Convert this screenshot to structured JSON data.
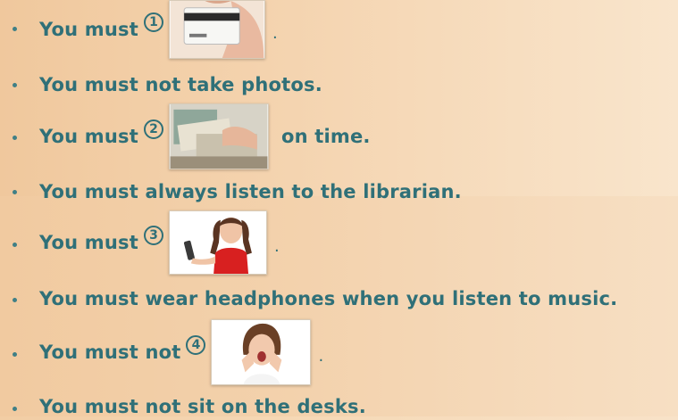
{
  "rules": [
    {
      "text_before": "You must",
      "number": "1",
      "photo": "card-photo",
      "text_after": "."
    },
    {
      "text": "You must not take photos."
    },
    {
      "text_before": "You must",
      "number": "2",
      "photo": "books-photo",
      "text_after": "on time."
    },
    {
      "text": "You must always listen to the librarian."
    },
    {
      "text_before": "You must",
      "number": "3",
      "photo": "phone-girl-photo",
      "text_after": "."
    },
    {
      "text": "You must wear headphones when you listen to music."
    },
    {
      "text_before": "You must not",
      "number": "4",
      "photo": "shouting-girl-photo",
      "text_after": "."
    },
    {
      "text": "You must not sit on the desks."
    }
  ],
  "colors": {
    "text": "#2f7078",
    "background": "#f5d6b3"
  }
}
